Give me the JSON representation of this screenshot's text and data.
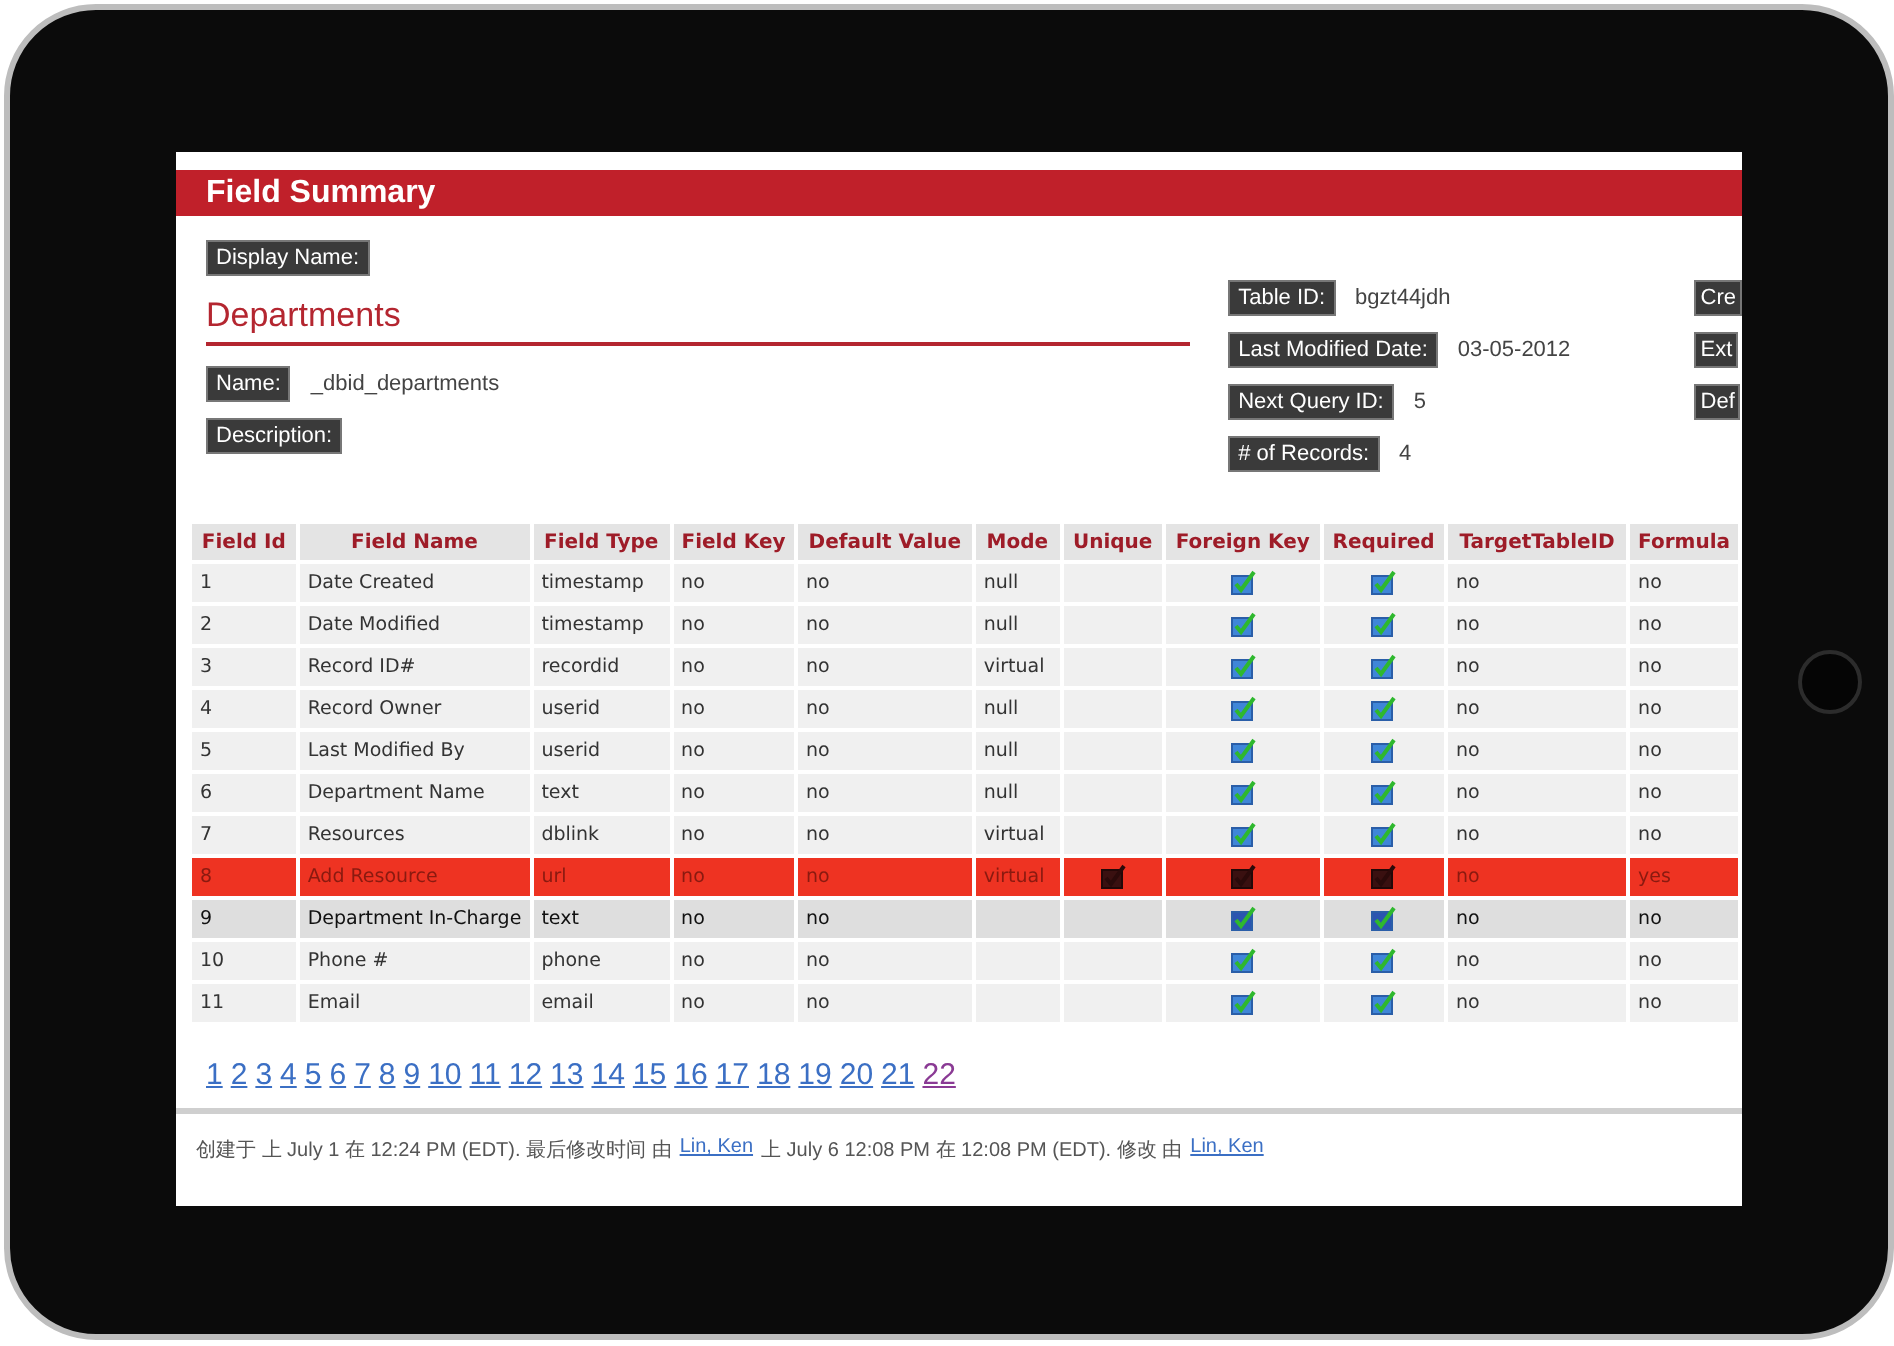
{
  "header": {
    "title": "Field Summary"
  },
  "display_name_label": "Display Name:",
  "table_title": "Departments",
  "left_fields": [
    {
      "label": "Name:",
      "value": "_dbid_departments"
    },
    {
      "label": "Description:"
    }
  ],
  "middle_fields": [
    {
      "label": "Table ID:",
      "value": "bgzt44jdh"
    },
    {
      "label": "Last Modified Date:",
      "value": "03-05-2012"
    },
    {
      "label": "Next Query ID:",
      "value": "5"
    },
    {
      "label": "# of Records:",
      "value": "4"
    }
  ],
  "right_fields": [
    {
      "label": "Cre"
    },
    {
      "label": "Ext"
    },
    {
      "label": "Def"
    }
  ],
  "table": {
    "columns": [
      "Field Id",
      "Field Name",
      "Field Type",
      "Field Key",
      "Default Value",
      "Mode",
      "Unique",
      "Foreign Key",
      "Required",
      "TargetTableID",
      "Formula"
    ],
    "rows": [
      {
        "id": "1",
        "name": "Date Created",
        "type": "timestamp",
        "key": "no",
        "default": "no",
        "mode": "null",
        "unique": false,
        "foreign_key": true,
        "required": true,
        "target": "no",
        "formula": "no",
        "selected": false,
        "hovered": false
      },
      {
        "id": "2",
        "name": "Date Modified",
        "type": "timestamp",
        "key": "no",
        "default": "no",
        "mode": "null",
        "unique": false,
        "foreign_key": true,
        "required": true,
        "target": "no",
        "formula": "no",
        "selected": false,
        "hovered": false
      },
      {
        "id": "3",
        "name": "Record ID#",
        "type": "recordid",
        "key": "no",
        "default": "no",
        "mode": "virtual",
        "unique": false,
        "foreign_key": true,
        "required": true,
        "target": "no",
        "formula": "no",
        "selected": false,
        "hovered": false
      },
      {
        "id": "4",
        "name": "Record Owner",
        "type": "userid",
        "key": "no",
        "default": "no",
        "mode": "null",
        "unique": false,
        "foreign_key": true,
        "required": true,
        "target": "no",
        "formula": "no",
        "selected": false,
        "hovered": false
      },
      {
        "id": "5",
        "name": "Last Modified By",
        "type": "userid",
        "key": "no",
        "default": "no",
        "mode": "null",
        "unique": false,
        "foreign_key": true,
        "required": true,
        "target": "no",
        "formula": "no",
        "selected": false,
        "hovered": false
      },
      {
        "id": "6",
        "name": "Department Name",
        "type": "text",
        "key": "no",
        "default": "no",
        "mode": "null",
        "unique": false,
        "foreign_key": true,
        "required": true,
        "target": "no",
        "formula": "no",
        "selected": false,
        "hovered": false
      },
      {
        "id": "7",
        "name": "Resources",
        "type": "dblink",
        "key": "no",
        "default": "no",
        "mode": "virtual",
        "unique": false,
        "foreign_key": true,
        "required": true,
        "target": "no",
        "formula": "no",
        "selected": false,
        "hovered": false
      },
      {
        "id": "8",
        "name": "Add Resource",
        "type": "url",
        "key": "no",
        "default": "no",
        "mode": "virtual",
        "unique": true,
        "foreign_key": true,
        "required": true,
        "target": "no",
        "formula": "yes",
        "selected": true,
        "hovered": false
      },
      {
        "id": "9",
        "name": "Department In-Charge",
        "type": "text",
        "key": "no",
        "default": "no",
        "unique": false,
        "foreign_key": true,
        "required": true,
        "target": "no",
        "formula": "no",
        "selected": false,
        "hovered": true
      },
      {
        "id": "10",
        "name": "Phone #",
        "type": "phone",
        "key": "no",
        "default": "no",
        "unique": false,
        "foreign_key": true,
        "required": true,
        "target": "no",
        "formula": "no",
        "selected": false,
        "hovered": false
      },
      {
        "id": "11",
        "name": "Email",
        "type": "email",
        "key": "no",
        "default": "no",
        "unique": false,
        "foreign_key": true,
        "required": true,
        "target": "no",
        "formula": "no",
        "selected": false,
        "hovered": false
      }
    ]
  },
  "pages": [
    {
      "label": "1",
      "selected": false
    },
    {
      "label": "2",
      "selected": false
    },
    {
      "label": "3",
      "selected": false
    },
    {
      "label": "4",
      "selected": false
    },
    {
      "label": "5",
      "selected": false
    },
    {
      "label": "6",
      "selected": false
    },
    {
      "label": "7",
      "selected": false
    },
    {
      "label": "8",
      "selected": false
    },
    {
      "label": "9",
      "selected": false
    },
    {
      "label": "10",
      "selected": false
    },
    {
      "label": "11",
      "selected": false
    },
    {
      "label": "12",
      "selected": false
    },
    {
      "label": "13",
      "selected": false
    },
    {
      "label": "14",
      "selected": false
    },
    {
      "label": "15",
      "selected": false
    },
    {
      "label": "16",
      "selected": false
    },
    {
      "label": "17",
      "selected": false
    },
    {
      "label": "18",
      "selected": false
    },
    {
      "label": "19",
      "selected": false
    },
    {
      "label": "20",
      "selected": false
    },
    {
      "label": "21",
      "selected": false
    },
    {
      "label": "22",
      "selected": true
    }
  ],
  "footer": [
    {
      "kind": "text",
      "text": "创建于 上 July 1 在 12:24 PM (EDT). 最后修改时间 由"
    },
    {
      "kind": "link",
      "text": "Lin, Ken"
    },
    {
      "kind": "text",
      "text": "上 July 6 12:08 PM 在 12:08 PM (EDT). 修改 由"
    },
    {
      "kind": "link",
      "text": "Lin, Ken"
    }
  ]
}
